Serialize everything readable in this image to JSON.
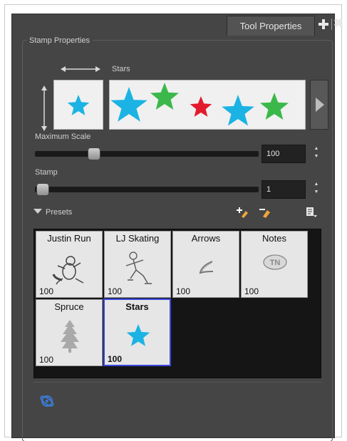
{
  "window": {
    "tab_title": "Tool Properties"
  },
  "stamp_properties": {
    "group_title": "Stamp Properties",
    "stamp_name": "Stars",
    "preview_color": "#1bb3e3",
    "strip_stars": [
      {
        "color": "#1bb3e3"
      },
      {
        "color": "#3bb84a"
      },
      {
        "color": "#e21b2c"
      },
      {
        "color": "#1bb3e3"
      },
      {
        "color": "#3bb84a"
      }
    ]
  },
  "maximum_scale": {
    "label": "Maximum Scale",
    "value": "100"
  },
  "stamp": {
    "label": "Stamp",
    "value": "1"
  },
  "presets": {
    "label": "Presets",
    "items": [
      {
        "name": "Justin Run",
        "value": "100",
        "icon": "beaver-running-icon"
      },
      {
        "name": "LJ Skating",
        "value": "100",
        "icon": "skater-icon"
      },
      {
        "name": "Arrows",
        "value": "100",
        "icon": "arrow-stroke-icon"
      },
      {
        "name": "Notes",
        "value": "100",
        "icon": "tn-notes-icon"
      },
      {
        "name": "Spruce",
        "value": "100",
        "icon": "spruce-tree-icon"
      },
      {
        "name": "Stars",
        "value": "100",
        "icon": "star-icon",
        "selected": true
      }
    ]
  },
  "colors": {
    "panel_bg": "#454545",
    "selection": "#3b47e0",
    "star_blue": "#1bb3e3",
    "star_green": "#3bb84a",
    "star_red": "#e21b2c"
  }
}
